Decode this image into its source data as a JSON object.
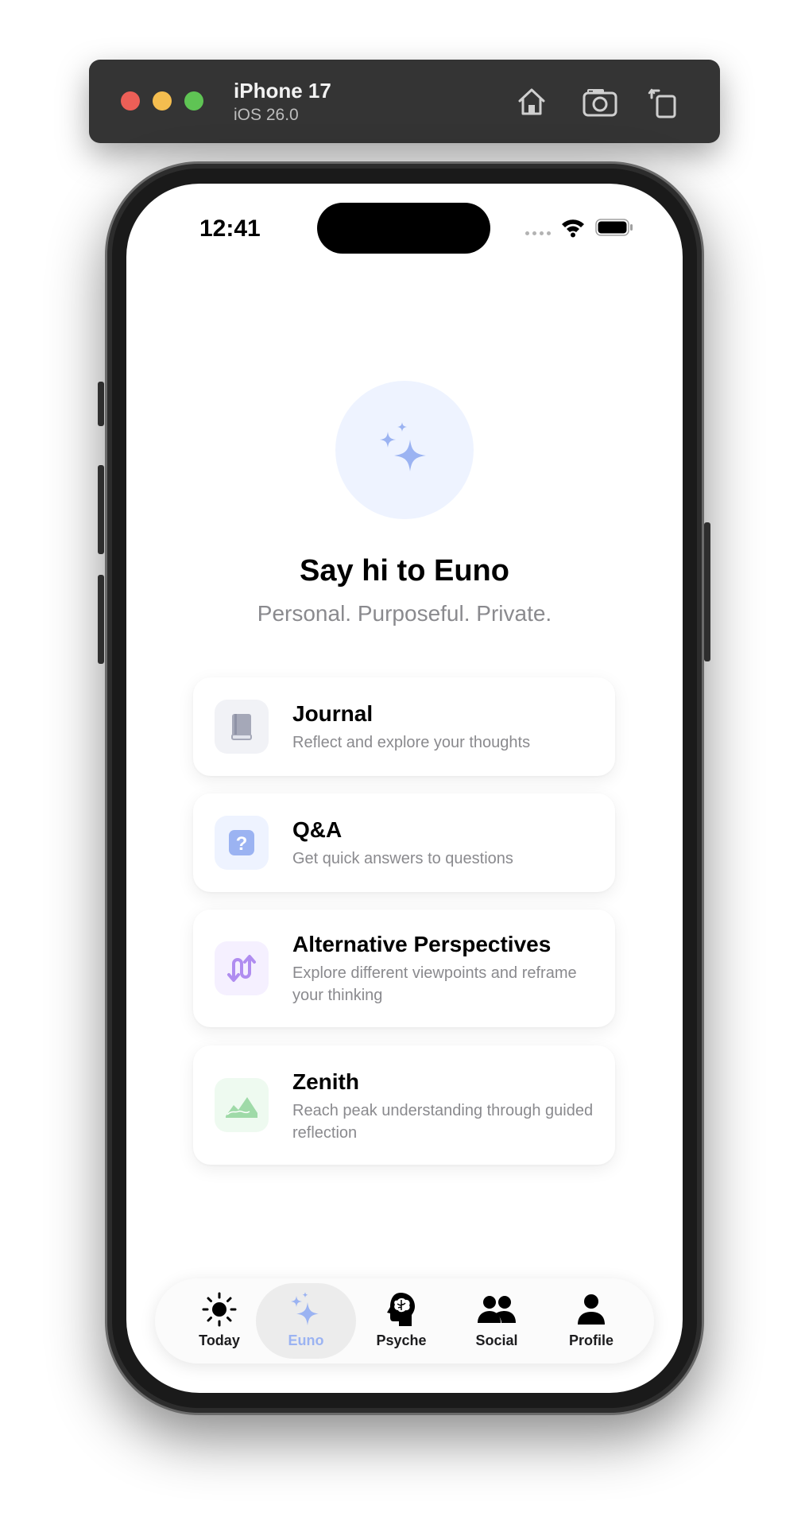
{
  "simulator": {
    "device_name": "iPhone 17",
    "os_version": "iOS 26.0",
    "buttons": [
      "home-icon",
      "screenshot-icon",
      "rotate-icon"
    ]
  },
  "status_bar": {
    "time": "12:41"
  },
  "hero": {
    "icon": "sparkles-icon",
    "title": "Say hi to Euno",
    "subtitle": "Personal. Purposeful. Private."
  },
  "cards": [
    {
      "icon": "book-icon",
      "title": "Journal",
      "description": "Reflect and explore your thoughts",
      "icon_color": "#a5a8b8",
      "icon_bg": "#f1f2f6"
    },
    {
      "icon": "question-icon",
      "title": "Q&A",
      "description": "Get quick answers to questions",
      "icon_color": "#9bb3f2",
      "icon_bg": "#eef3ff"
    },
    {
      "icon": "arrows-swap-icon",
      "title": "Alternative Perspectives",
      "description": "Explore different viewpoints and reframe your thinking",
      "icon_color": "#b08df0",
      "icon_bg": "#f5f0ff"
    },
    {
      "icon": "mountains-icon",
      "title": "Zenith",
      "description": "Reach peak understanding through guided reflection",
      "icon_color": "#9fdaa8",
      "icon_bg": "#eefaf0"
    }
  ],
  "tab_bar": {
    "tabs": [
      {
        "label": "Today",
        "icon": "sun-icon",
        "active": false
      },
      {
        "label": "Euno",
        "icon": "sparkles-icon",
        "active": true
      },
      {
        "label": "Psyche",
        "icon": "brain-head-icon",
        "active": false
      },
      {
        "label": "Social",
        "icon": "people-icon",
        "active": false
      },
      {
        "label": "Profile",
        "icon": "person-icon",
        "active": false
      }
    ]
  },
  "colors": {
    "accent": "#9bb3f2",
    "hero_bg": "#eef3ff",
    "secondary_text": "#8a8a8e"
  }
}
